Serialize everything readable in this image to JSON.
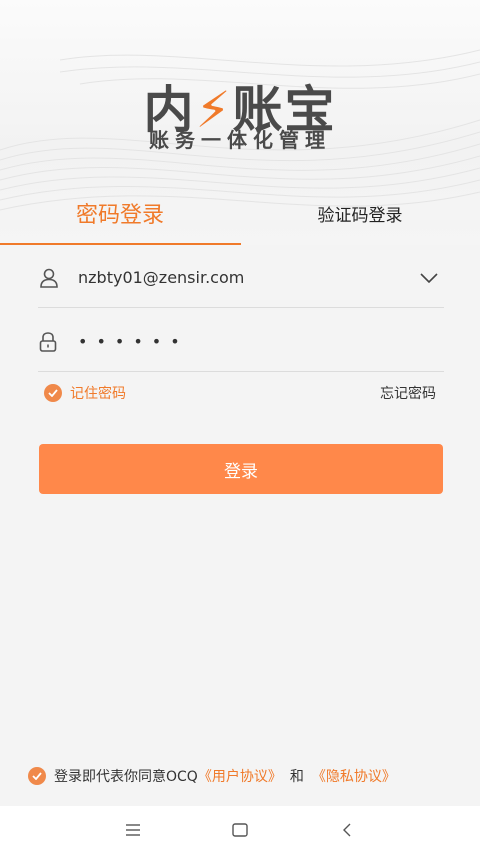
{
  "brand": {
    "logo_part1": "内",
    "logo_part2": "账宝",
    "slogan": "账务一体化管理"
  },
  "tabs": {
    "password_login": "密码登录",
    "code_login": "验证码登录"
  },
  "form": {
    "username_value": "nzbty01@zensir.com",
    "password_masked": "••••••",
    "remember_label": "记住密码",
    "remember_checked": true,
    "forgot_label": "忘记密码"
  },
  "login_button": "登录",
  "agreement": {
    "text": "登录即代表你同意OCQ",
    "user_agreement": "《用户协议》",
    "and": "和",
    "privacy_agreement": "《隐私协议》",
    "checked": true
  },
  "colors": {
    "accent": "#f07a2a",
    "button": "#ff884a",
    "background": "#f4f4f4"
  },
  "icons": {
    "user": "user-icon",
    "lock": "lock-icon",
    "dropdown": "chevron-down-icon",
    "check": "check-icon",
    "nav_menu": "menu-icon",
    "nav_home": "home-square-icon",
    "nav_back": "back-icon"
  }
}
